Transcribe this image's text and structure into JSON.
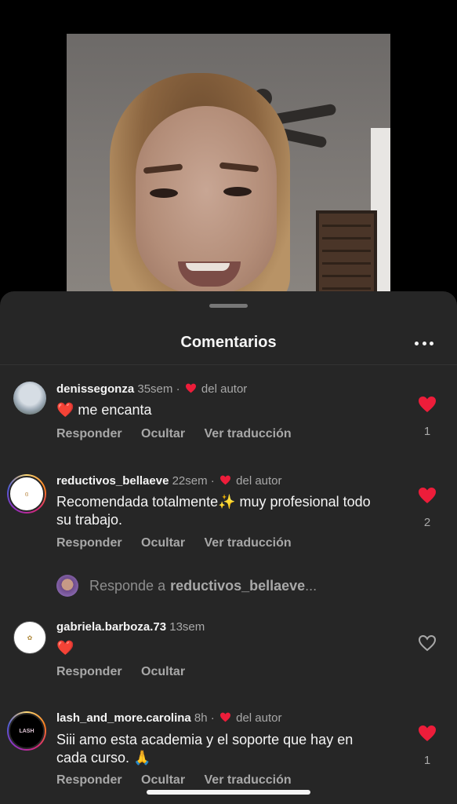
{
  "sheet": {
    "title": "Comentarios"
  },
  "colors": {
    "heart": "#ed1d3a",
    "background": "#262626",
    "muted": "#a8a8a8"
  },
  "comments": [
    {
      "user": "denissegonza",
      "time": "35sem",
      "author_label": "del autor",
      "liked_by_author": true,
      "text": "❤️ me encanta",
      "actions": [
        "Responder",
        "Ocultar",
        "Ver traducción"
      ],
      "likes": "1",
      "liked": true
    },
    {
      "user": "reductivos_bellaeve",
      "time": "22sem",
      "author_label": "del autor",
      "liked_by_author": true,
      "text": "Recomendada totalmente✨ muy profesional todo su trabajo.",
      "actions": [
        "Responder",
        "Ocultar",
        "Ver traducción"
      ],
      "likes": "2",
      "liked": true
    },
    {
      "user": "gabriela.barboza.73",
      "time": "13sem",
      "author_label": "",
      "liked_by_author": false,
      "text": "❤️",
      "actions": [
        "Responder",
        "Ocultar"
      ],
      "likes": "",
      "liked": false
    },
    {
      "user": "lash_and_more.carolina",
      "time": "8h",
      "author_label": "del autor",
      "liked_by_author": true,
      "text": "Siii amo esta academia y el soporte que hay en cada curso. 🙏",
      "actions": [
        "Responder",
        "Ocultar",
        "Ver traducción"
      ],
      "likes": "1",
      "liked": true
    }
  ],
  "reply_prompt": {
    "prefix": "Responde a",
    "user": "reductivos_bellaeve",
    "suffix": "..."
  },
  "separator": "·",
  "icons": {
    "more": "more-horizontal-icon",
    "heart": "heart-icon"
  }
}
